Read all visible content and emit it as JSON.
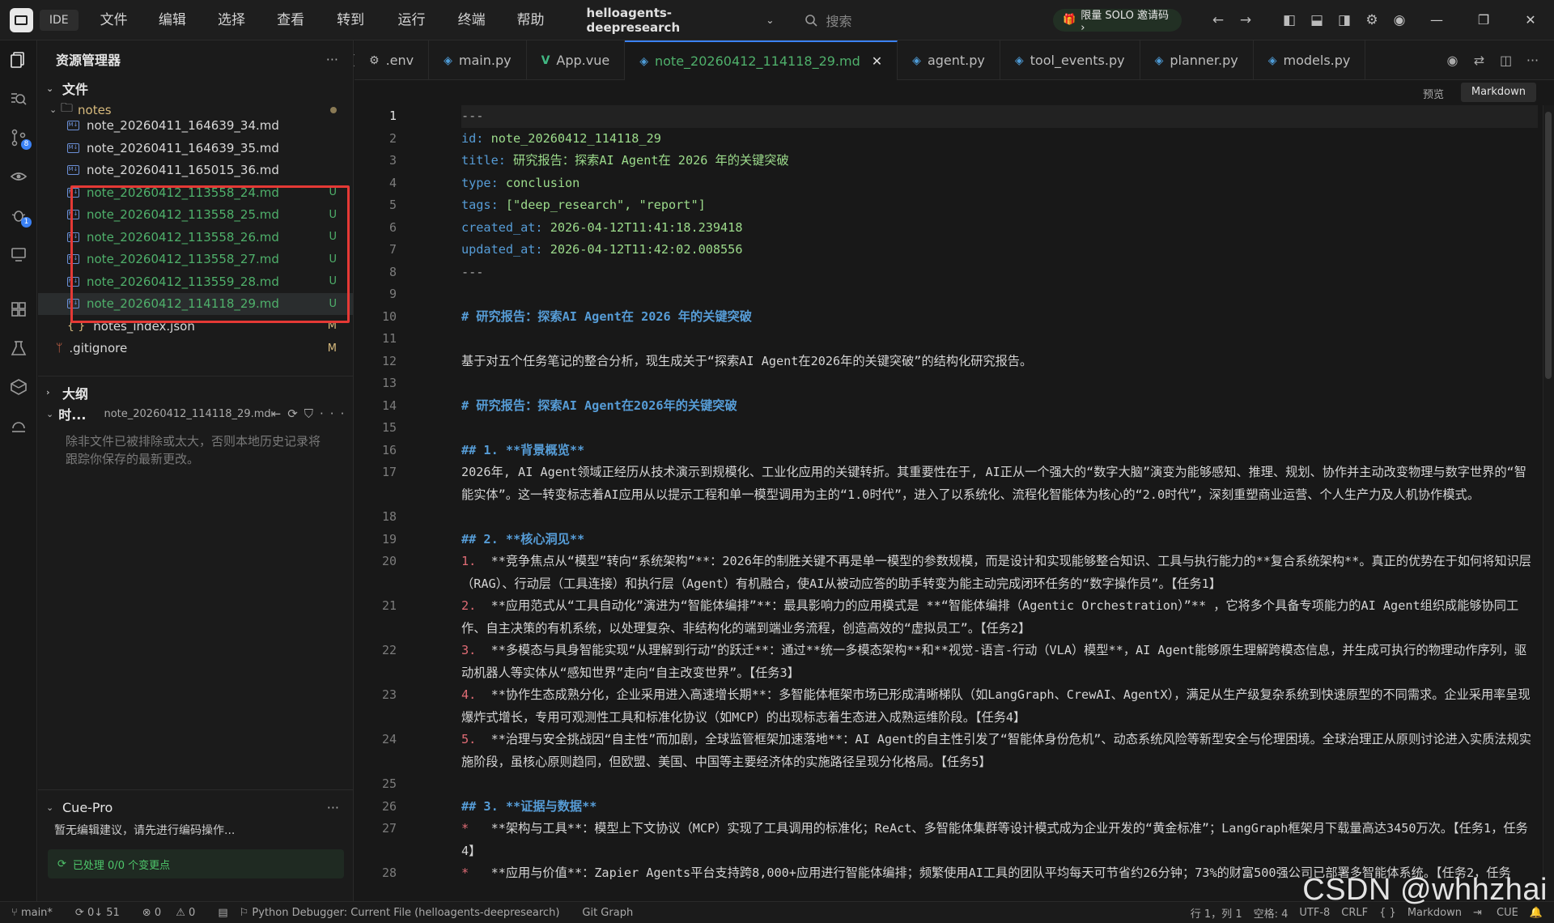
{
  "titlebar": {
    "ide_label": "IDE",
    "menu": [
      "文件(F)",
      "编辑(E)",
      "选择(S)",
      "查看(V)",
      "转到(G)",
      "运行(R)",
      "终端(T)",
      "帮助(H)"
    ],
    "project": "helloagents-deepresearch",
    "search_placeholder": "搜索",
    "solo_label": "限量 SOLO 邀请码 ›"
  },
  "activity": {
    "scm_badge": "8",
    "debug_badge": "1"
  },
  "sidebar": {
    "title": "资源管理器",
    "files_section": "文件",
    "folder": "notes",
    "files": [
      {
        "name": "note_20260411_164639_34.md",
        "status": ""
      },
      {
        "name": "note_20260411_164639_35.md",
        "status": ""
      },
      {
        "name": "note_20260411_165015_36.md",
        "status": ""
      },
      {
        "name": "note_20260412_113558_24.md",
        "status": "U"
      },
      {
        "name": "note_20260412_113558_25.md",
        "status": "U"
      },
      {
        "name": "note_20260412_113558_26.md",
        "status": "U"
      },
      {
        "name": "note_20260412_113558_27.md",
        "status": "U"
      },
      {
        "name": "note_20260412_113559_28.md",
        "status": "U"
      },
      {
        "name": "note_20260412_114118_29.md",
        "status": "U"
      }
    ],
    "notes_index": {
      "name": "notes_index.json",
      "status": "M"
    },
    "gitignore": {
      "name": ".gitignore",
      "status": "M"
    },
    "outline_section": "大纲",
    "timeline_section": "时...",
    "timeline_file": "note_20260412_114118_29.md",
    "timeline_hint": "除非文件已被排除或太大，否则本地历史记录将跟踪你保存的最新更改。",
    "cue_title": "Cue-Pro",
    "cue_tip": "暂无编辑建议，请先进行编码操作...",
    "cue_status": "已处理 0/0 个变更点"
  },
  "tabs": [
    {
      "label": ".env",
      "icon": "⚙",
      "active": false
    },
    {
      "label": "main.py",
      "icon": "◈",
      "active": false
    },
    {
      "label": "App.vue",
      "icon": "V",
      "active": false
    },
    {
      "label": "note_20260412_114118_29.md",
      "icon": "◈",
      "active": true
    },
    {
      "label": "agent.py",
      "icon": "◈",
      "active": false
    },
    {
      "label": "tool_events.py",
      "icon": "◈",
      "active": false
    },
    {
      "label": "planner.py",
      "icon": "◈",
      "active": false
    },
    {
      "label": "models.py",
      "icon": "◈",
      "active": false
    }
  ],
  "mode_bar": {
    "preview": "预览",
    "markdown": "Markdown"
  },
  "editor": {
    "lines": [
      {
        "n": "1",
        "t": "---"
      },
      {
        "n": "2",
        "t": "id: note_20260412_114118_29"
      },
      {
        "n": "3",
        "t": "title: 研究报告：探索AI Agent在 2026 年的关键突破"
      },
      {
        "n": "4",
        "t": "type: conclusion"
      },
      {
        "n": "5",
        "t": "tags: [\"deep_research\", \"report\"]"
      },
      {
        "n": "6",
        "t": "created_at: 2026-04-12T11:41:18.239418"
      },
      {
        "n": "7",
        "t": "updated_at: 2026-04-12T11:42:02.008556"
      },
      {
        "n": "8",
        "t": "---"
      },
      {
        "n": "9",
        "t": ""
      },
      {
        "n": "10",
        "t": "# 研究报告：探索AI Agent在 2026 年的关键突破"
      },
      {
        "n": "11",
        "t": ""
      },
      {
        "n": "12",
        "t": "基于对五个任务笔记的整合分析，现生成关于“探索AI Agent在2026年的关键突破”的结构化研究报告。"
      },
      {
        "n": "13",
        "t": ""
      },
      {
        "n": "14",
        "t": "# 研究报告：探索AI Agent在2026年的关键突破"
      },
      {
        "n": "15",
        "t": ""
      },
      {
        "n": "16",
        "t": "## 1. **背景概览**"
      },
      {
        "n": "17",
        "t": "2026年, AI Agent领域正经历从技术演示到规模化、工业化应用的关键转折。其重要性在于, AI正从一个强大的“数字大脑”演变为能够感知、推理、规划、协作并主动改变物理与数字世界的“智能实体”。这一转变标志着AI应用从以提示工程和单一模型调用为主的“1.0时代”，进入了以系统化、流程化智能体为核心的“2.0时代”，深刻重塑商业运营、个人生产力及人机协作模式。"
      },
      {
        "n": "18",
        "t": ""
      },
      {
        "n": "19",
        "t": "## 2. **核心洞见**"
      },
      {
        "n": "20",
        "t": "1.  **竞争焦点从“模型”转向“系统架构”**：2026年的制胜关键不再是单一模型的参数规模，而是设计和实现能够整合知识、工具与执行能力的**复合系统架构**。真正的优势在于如何将知识层（RAG）、行动层（工具连接）和执行层（Agent）有机融合，使AI从被动应答的助手转变为能主动完成闭环任务的“数字操作员”。【任务1】"
      },
      {
        "n": "21",
        "t": "2.  **应用范式从“工具自动化”演进为“智能体编排”**：最具影响力的应用模式是 **“智能体编排（Agentic Orchestration）”** ，它将多个具备专项能力的AI Agent组织成能够协同工作、自主决策的有机系统，以处理复杂、非结构化的端到端业务流程，创造高效的“虚拟员工”。【任务2】"
      },
      {
        "n": "22",
        "t": "3.  **多模态与具身智能实现“从理解到行动”的跃迁**：通过**统一多模态架构**和**视觉-语言-行动（VLA）模型**，AI Agent能够原生理解跨模态信息，并生成可执行的物理动作序列，驱动机器人等实体从“感知世界”走向“自主改变世界”。【任务3】"
      },
      {
        "n": "23",
        "t": "4.  **协作生态成熟分化，企业采用进入高速增长期**：多智能体框架市场已形成清晰梯队（如LangGraph、CrewAI、AgentX），满足从生产级复杂系统到快速原型的不同需求。企业采用率呈现爆炸式增长，专用可观测性工具和标准化协议（如MCP）的出现标志着生态进入成熟运维阶段。【任务4】"
      },
      {
        "n": "24",
        "t": "5.  **治理与安全挑战因“自主性”而加剧，全球监管框架加速落地**：AI Agent的自主性引发了“智能体身份危机”、动态系统风险等新型安全与伦理困境。全球治理正从原则讨论进入实质法规实施阶段，虽核心原则趋同，但欧盟、美国、中国等主要经济体的实施路径呈现分化格局。【任务5】"
      },
      {
        "n": "25",
        "t": ""
      },
      {
        "n": "26",
        "t": "## 3. **证据与数据**"
      },
      {
        "n": "27",
        "t": "*   **架构与工具**：模型上下文协议（MCP）实现了工具调用的标准化；ReAct、多智能体集群等设计模式成为企业开发的“黄金标准”；LangGraph框架月下载量高达3450万次。【任务1，任务4】"
      },
      {
        "n": "28",
        "t": "*   **应用与价值**：Zapier Agents平台支持跨8,000+应用进行智能体编排；频繁使用AI工具的团队平均每天可节省约26分钟；73%的财富500强公司已部署多智能体系统。【任务2，任务"
      }
    ]
  },
  "statusbar": {
    "branch": "main*",
    "sync": "0↓ 51",
    "errors": "0",
    "warnings": "0",
    "debug": "Python Debugger: Current File (helloagents-deepresearch)",
    "git_graph": "Git Graph",
    "position": "行 1，列 1",
    "spaces": "空格: 4",
    "encoding": "UTF-8",
    "eol": "CRLF",
    "braces": "{ }",
    "language": "Markdown",
    "cue": "CUE"
  },
  "watermark": "CSDN @whhzhai"
}
